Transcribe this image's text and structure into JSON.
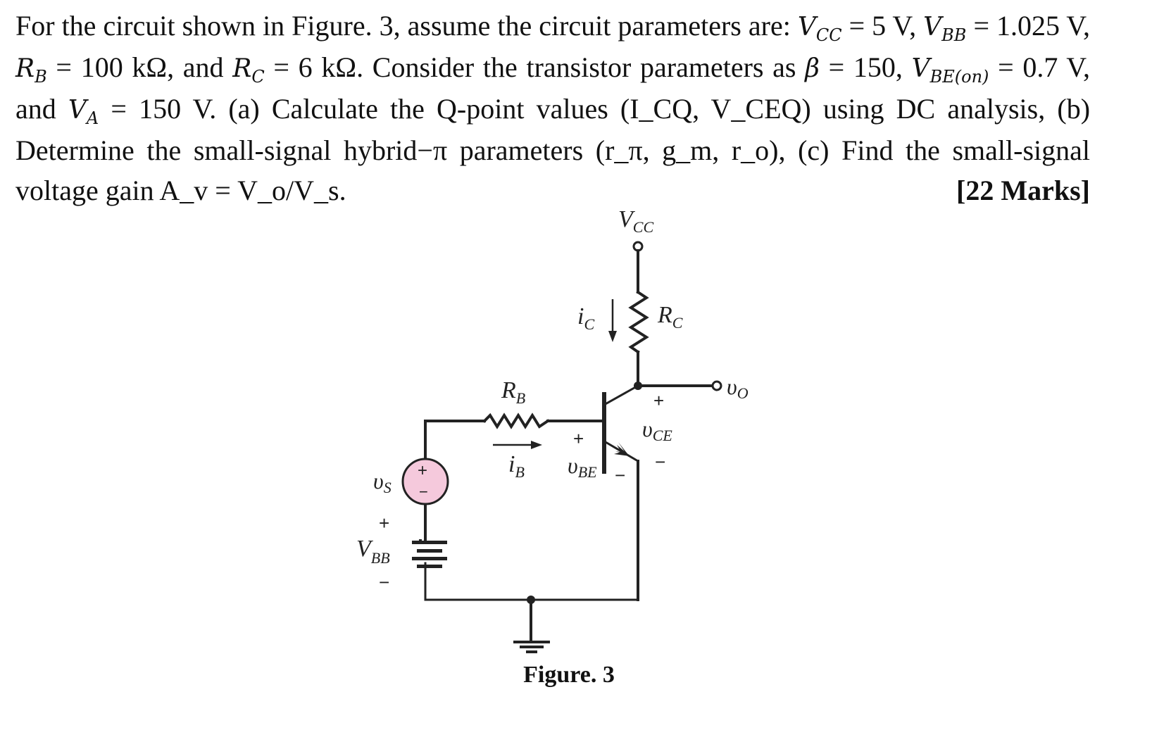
{
  "problem": {
    "intro": "For the circuit shown in Figure. 3, assume the circuit parameters are:",
    "params": {
      "VCC": "5 V",
      "VBB": "1.025 V",
      "RB": "100 kΩ",
      "RC": "6 kΩ",
      "beta": "150",
      "VBE_on": "0.7 V",
      "VA": "150 V"
    },
    "text_consider": "Consider the transistor parameters as",
    "part_a": "(a) Calculate the Q-point values (I_CQ, V_CEQ) using DC analysis,",
    "part_b": "(b) Determine the small-signal hybrid−π parameters (r_π, g_m, r_o),",
    "part_c": "(c) Find the small-signal voltage gain A_v = V_o/V_s.",
    "marks": "[22 Marks]"
  },
  "figure": {
    "caption": "Figure. 3",
    "labels": {
      "vcc": "V",
      "vcc_sub": "CC",
      "rc": "R",
      "rc_sub": "C",
      "ic": "i",
      "ic_sub": "C",
      "rb": "R",
      "rb_sub": "B",
      "ib": "i",
      "ib_sub": "B",
      "vo": "υ",
      "vo_sub": "O",
      "vce": "υ",
      "vce_sub": "CE",
      "vbe": "υ",
      "vbe_sub": "BE",
      "vs": "υ",
      "vs_sub": "S",
      "vbb": "V",
      "vbb_sub": "BB",
      "plus": "+",
      "minus": "−"
    },
    "colors": {
      "source_fill": "#f5c9dc",
      "wire": "#222222"
    }
  }
}
